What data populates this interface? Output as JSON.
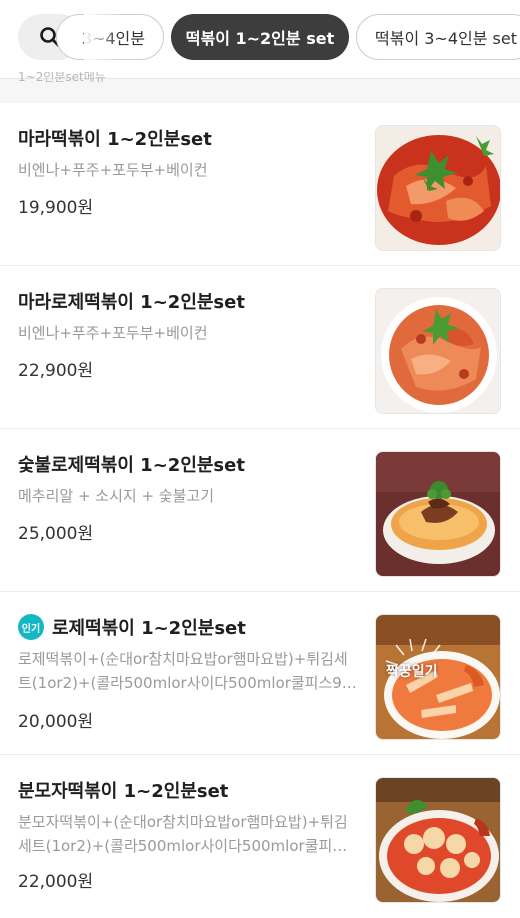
{
  "header": {
    "search_icon": "search-icon",
    "chips": [
      {
        "label": "3~4인분",
        "active": false
      },
      {
        "label": "떡볶이 1~2인분 set",
        "active": true
      },
      {
        "label": "떡볶이 3~4인분 set",
        "active": false
      }
    ],
    "section_label": "1~2인분set메뉴"
  },
  "items": [
    {
      "title": "마라떡볶이 1~2인분set",
      "desc": "비엔나+푸주+포두부+베이컨",
      "price": "19,900원",
      "popular": false
    },
    {
      "title": "마라로제떡볶이 1~2인분set",
      "desc": "비엔나+푸주+포두부+베이컨",
      "price": "22,900원",
      "popular": false
    },
    {
      "title": "숯불로제떡볶이 1~2인분set",
      "desc": "메추리알 + 소시지 + 숯불고기",
      "price": "25,000원",
      "popular": false
    },
    {
      "title": "로제떡볶이 1~2인분set",
      "desc": "로제떡볶이+(순대or참치마요밥or햄마요밥)+튀김세트(1or2)+(콜라500mlor사이다500mlor쿨피스9…",
      "price": "20,000원",
      "popular": true,
      "badge": "인기",
      "image_text": "짝꿍일기"
    },
    {
      "title": "분모자떡볶이 1~2인분set",
      "desc": "분모자떡볶이+(순대or참치마요밥or햄마요밥)+튀김세트(1or2)+(콜라500mlor사이다500mlor쿨피스…",
      "price": "22,000원",
      "popular": false
    }
  ],
  "colors": {
    "active_chip": "#3d3d3d",
    "badge": "#14b8c4"
  }
}
